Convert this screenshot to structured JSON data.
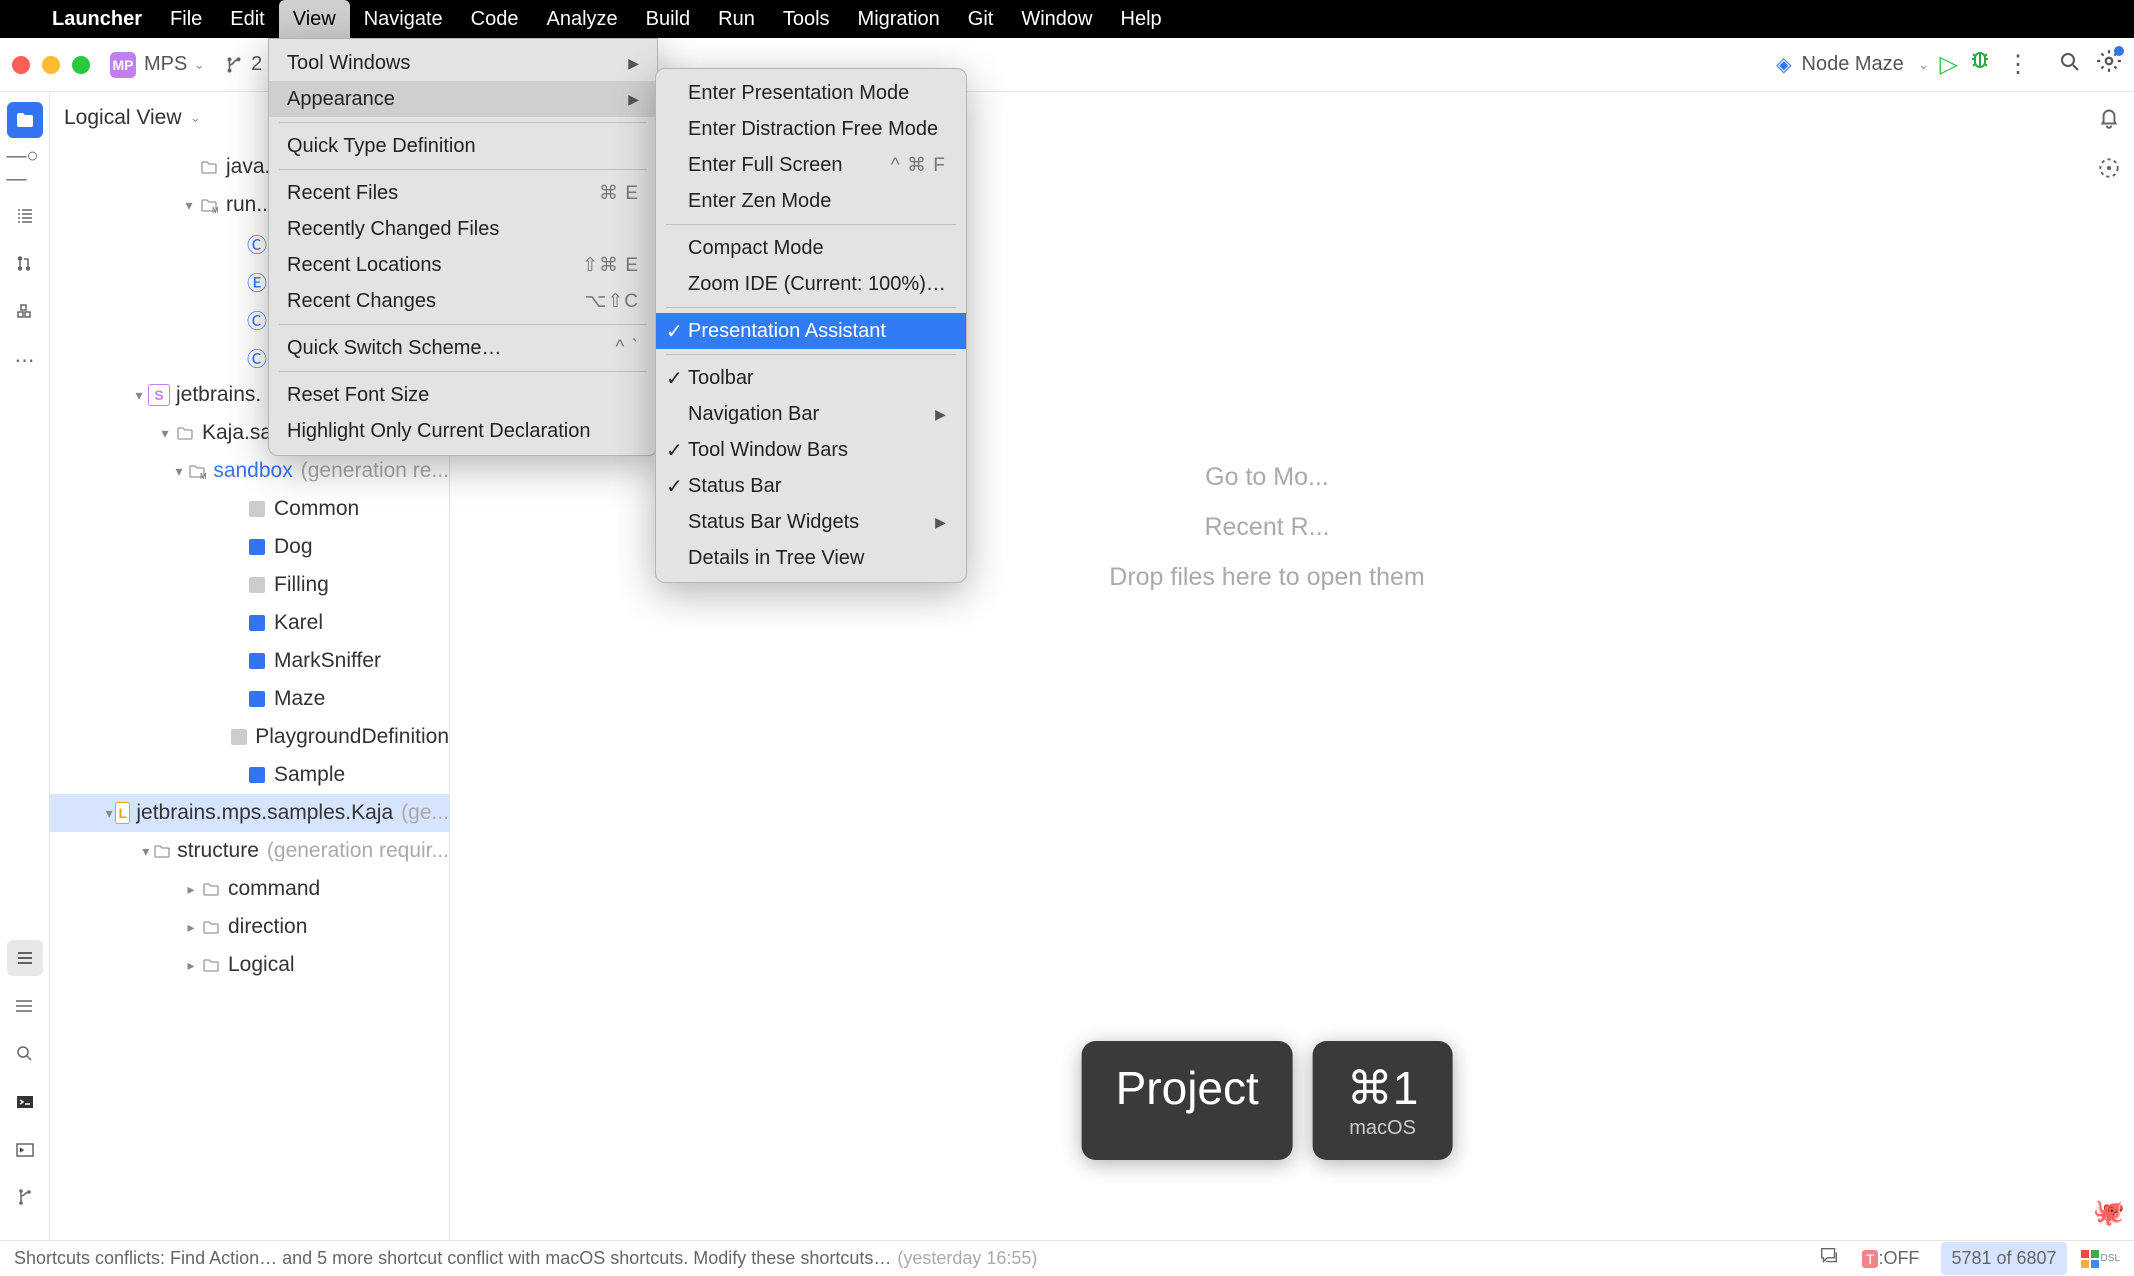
{
  "macos_menubar": {
    "app": "Launcher",
    "items": [
      "File",
      "Edit",
      "View",
      "Navigate",
      "Code",
      "Analyze",
      "Build",
      "Run",
      "Tools",
      "Migration",
      "Git",
      "Window",
      "Help"
    ]
  },
  "toolbar": {
    "mps_badge": "MP",
    "project_name": "MPS",
    "branch_number": "2",
    "run_config": "Node Maze"
  },
  "project_panel": {
    "header": "Logical View",
    "tree": [
      {
        "indent": 130,
        "chev": "",
        "icon": "folder",
        "label": "java..."
      },
      {
        "indent": 130,
        "chev": "▾",
        "icon": "folder-m",
        "label": "run..."
      },
      {
        "indent": 178,
        "chev": "",
        "icon": "c",
        "label": ""
      },
      {
        "indent": 178,
        "chev": "",
        "icon": "e",
        "label": ""
      },
      {
        "indent": 178,
        "chev": "",
        "icon": "c",
        "label": ""
      },
      {
        "indent": 178,
        "chev": "",
        "icon": "c",
        "label": ""
      },
      {
        "indent": 80,
        "chev": "▾",
        "icon": "s",
        "label": "jetbrains."
      },
      {
        "indent": 106,
        "chev": "▾",
        "icon": "folder",
        "label": "Kaja.sa..."
      },
      {
        "indent": 132,
        "chev": "▾",
        "icon": "folder-m",
        "label": "sandbox",
        "link": true,
        "suffix": "(generation re..."
      },
      {
        "indent": 178,
        "chev": "",
        "icon": "gray-sq",
        "label": "Common"
      },
      {
        "indent": 178,
        "chev": "",
        "icon": "blue-sq",
        "label": "Dog"
      },
      {
        "indent": 178,
        "chev": "",
        "icon": "gray-sq",
        "label": "Filling"
      },
      {
        "indent": 178,
        "chev": "",
        "icon": "blue-sq",
        "label": "Karel"
      },
      {
        "indent": 178,
        "chev": "",
        "icon": "blue-sq",
        "label": "MarkSniffer"
      },
      {
        "indent": 178,
        "chev": "",
        "icon": "blue-sq",
        "label": "Maze"
      },
      {
        "indent": 178,
        "chev": "",
        "icon": "gray-sq",
        "label": "PlaygroundDefinition"
      },
      {
        "indent": 178,
        "chev": "",
        "icon": "blue-sq",
        "label": "Sample"
      },
      {
        "indent": 80,
        "chev": "▾",
        "icon": "l",
        "label": "jetbrains.mps.samples.Kaja",
        "suffix": "(ge...",
        "selected": true
      },
      {
        "indent": 108,
        "chev": "▾",
        "icon": "folder",
        "label": "structure",
        "suffix": "(generation requir..."
      },
      {
        "indent": 132,
        "chev": "▸",
        "icon": "folder",
        "label": "command"
      },
      {
        "indent": 132,
        "chev": "▸",
        "icon": "folder",
        "label": "direction"
      },
      {
        "indent": 132,
        "chev": "▸",
        "icon": "folder",
        "label": "Logical"
      }
    ]
  },
  "editor": {
    "hint1": "Go to Mo...",
    "hint2": "Recent R...",
    "hint3": "Drop files here to open them"
  },
  "presentation_assistant": {
    "action": "Project",
    "shortcut": "⌘1",
    "platform": "macOS"
  },
  "status_bar": {
    "msg_prefix": "Shortcuts conflicts: Find Action… and 5 more shortcut conflict with macOS shortcuts. Modify these shortcuts…",
    "timestamp": "(yesterday 16:55)",
    "toff_icon": "T",
    "toff": ":OFF",
    "counter": "5781 of 6807",
    "dsl": "DSL"
  },
  "view_menu": {
    "items": [
      {
        "label": "Tool Windows",
        "type": "submenu"
      },
      {
        "label": "Appearance",
        "type": "submenu",
        "hover": true
      },
      {
        "type": "sep"
      },
      {
        "label": "Quick Type Definition"
      },
      {
        "type": "sep"
      },
      {
        "label": "Recent Files",
        "shortcut": "⌘ E"
      },
      {
        "label": "Recently Changed Files"
      },
      {
        "label": "Recent Locations",
        "shortcut": "⇧⌘ E"
      },
      {
        "label": "Recent Changes",
        "shortcut": "⌥⇧C"
      },
      {
        "type": "sep"
      },
      {
        "label": "Quick Switch Scheme…",
        "shortcut": "^  `"
      },
      {
        "type": "sep"
      },
      {
        "label": "Reset Font Size"
      },
      {
        "label": "Highlight Only Current Declaration"
      }
    ]
  },
  "appearance_submenu": {
    "items": [
      {
        "label": "Enter Presentation Mode"
      },
      {
        "label": "Enter Distraction Free Mode"
      },
      {
        "label": "Enter Full Screen",
        "shortcut": "^ ⌘ F"
      },
      {
        "label": "Enter Zen Mode"
      },
      {
        "type": "sep"
      },
      {
        "label": "Compact Mode"
      },
      {
        "label": "Zoom IDE (Current: 100%)…"
      },
      {
        "type": "sep"
      },
      {
        "label": "Presentation Assistant",
        "checked": true,
        "highlighted": true
      },
      {
        "type": "sep"
      },
      {
        "label": "Toolbar",
        "checked": true
      },
      {
        "label": "Navigation Bar",
        "type": "submenu"
      },
      {
        "label": "Tool Window Bars",
        "checked": true
      },
      {
        "label": "Status Bar",
        "checked": true
      },
      {
        "label": "Status Bar Widgets",
        "type": "submenu"
      },
      {
        "label": "Details in Tree View"
      }
    ]
  }
}
